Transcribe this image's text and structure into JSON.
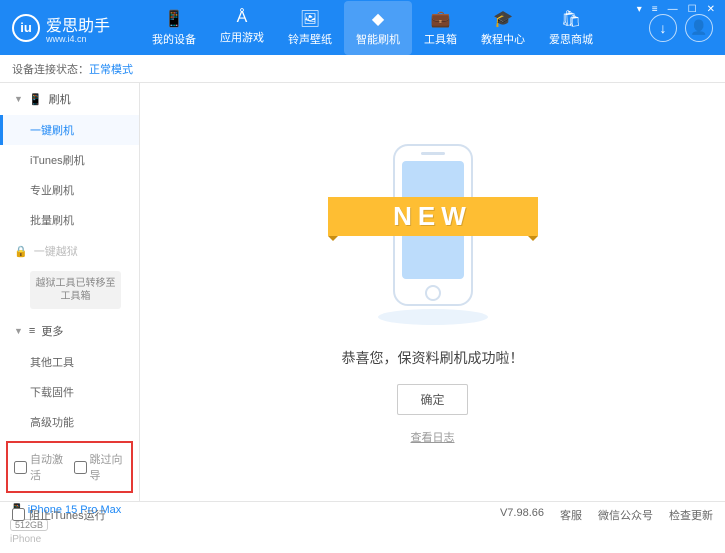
{
  "app": {
    "name": "爱思助手",
    "url": "www.i4.cn"
  },
  "nav": [
    {
      "label": "我的设备"
    },
    {
      "label": "应用游戏"
    },
    {
      "label": "铃声壁纸"
    },
    {
      "label": "智能刷机",
      "active": true
    },
    {
      "label": "工具箱"
    },
    {
      "label": "教程中心"
    },
    {
      "label": "爱思商城"
    }
  ],
  "status": {
    "label": "设备连接状态：",
    "mode": "正常模式"
  },
  "sidebar": {
    "sections": {
      "flash": {
        "title": "刷机",
        "items": [
          "一键刷机",
          "iTunes刷机",
          "专业刷机",
          "批量刷机"
        ],
        "activeIndex": 0
      },
      "jailbreak": {
        "title": "一键越狱",
        "note": "越狱工具已转移至工具箱"
      },
      "more": {
        "title": "更多",
        "items": [
          "其他工具",
          "下载固件",
          "高级功能"
        ]
      }
    },
    "checkbox1": "自动激活",
    "checkbox2": "跳过向导",
    "device": {
      "name": "iPhone 15 Pro Max",
      "capacity": "512GB",
      "type": "iPhone"
    }
  },
  "main": {
    "badge": "NEW",
    "message": "恭喜您，保资料刷机成功啦！",
    "confirm": "确定",
    "logLink": "查看日志"
  },
  "footer": {
    "blockItunes": "阻止iTunes运行",
    "version": "V7.98.66",
    "links": [
      "客服",
      "微信公众号",
      "检查更新"
    ]
  }
}
